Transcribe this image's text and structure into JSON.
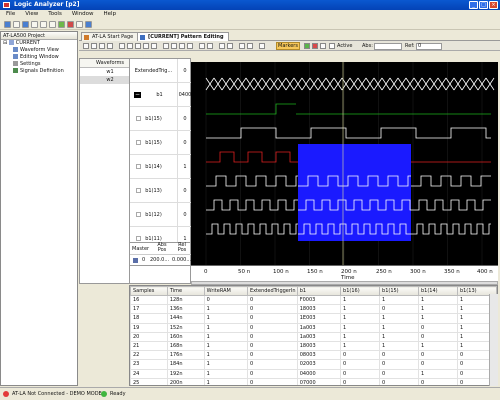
{
  "window": {
    "title": "Logic Analyzer [p2]"
  },
  "menu": [
    "File",
    "View",
    "Tools",
    "Window",
    "Help"
  ],
  "project": {
    "header": "AT-LA500 Project",
    "root": "CURRENT",
    "items": [
      "Waveform View",
      "Editing Window",
      "Settings",
      "Signals Definition"
    ]
  },
  "tabs": [
    {
      "label": "AT-LA Start Page",
      "active": false
    },
    {
      "label": "[CURRENT] Pattern Editing",
      "active": true
    }
  ],
  "controls": {
    "markers_label": "Markers",
    "active_label": "Active",
    "abs_label": "Abs:",
    "ref_label": "Ref:",
    "abs_value": "",
    "ref_value": "0"
  },
  "waveforms": {
    "header": "Waveforms",
    "items": [
      "w1",
      "w2"
    ],
    "selected": "w2"
  },
  "signals": [
    {
      "name": "ExtendedTrig...",
      "value": "0",
      "color": "#ffffff"
    },
    {
      "name": "b1",
      "value": "0400",
      "color": "#ffffff",
      "group": true
    },
    {
      "name": "b1(15)",
      "value": "0",
      "color": "#1db11d"
    },
    {
      "name": "b1(15)",
      "value": "0",
      "color": "#ffffff"
    },
    {
      "name": "b1(14)",
      "value": "1",
      "color": "#e02020"
    },
    {
      "name": "b1(13)",
      "value": "0",
      "color": "#ffffff"
    },
    {
      "name": "b1(12)",
      "value": "0",
      "color": "#ffffff"
    },
    {
      "name": "b1(11)",
      "value": "1",
      "color": "#ffffff"
    }
  ],
  "marker_table": {
    "headers": [
      "Master",
      "Abs Pos",
      "Rel Pos"
    ],
    "row": [
      "0",
      "200.0...",
      "0.000..."
    ]
  },
  "axis": {
    "ticks": [
      "0",
      "50 n",
      "100 n",
      "150 n",
      "200 n",
      "250 n",
      "300 n",
      "350 n",
      "400 n"
    ],
    "label": "Time"
  },
  "grid": {
    "headers": [
      "Samples",
      "Time",
      "WriteRAM",
      "ExtendedTriggerIn",
      "b1",
      "b1(16)",
      "b1(15)",
      "b1(14)",
      "b1(13)"
    ],
    "rows": [
      [
        "16",
        "128n",
        "0",
        "0",
        "F0003",
        "1",
        "1",
        "1",
        "1"
      ],
      [
        "17",
        "136n",
        "1",
        "0",
        "18003",
        "1",
        "0",
        "1",
        "1"
      ],
      [
        "18",
        "144n",
        "1",
        "0",
        "1E003",
        "1",
        "1",
        "1",
        "1"
      ],
      [
        "19",
        "152n",
        "1",
        "0",
        "1a003",
        "1",
        "1",
        "0",
        "1"
      ],
      [
        "20",
        "160n",
        "1",
        "0",
        "1a003",
        "1",
        "1",
        "0",
        "1"
      ],
      [
        "21",
        "168n",
        "1",
        "0",
        "18003",
        "1",
        "1",
        "1",
        "1"
      ],
      [
        "22",
        "176n",
        "1",
        "0",
        "08003",
        "0",
        "0",
        "0",
        "0"
      ],
      [
        "23",
        "184n",
        "1",
        "0",
        "02003",
        "0",
        "0",
        "0",
        "0"
      ],
      [
        "24",
        "192n",
        "1",
        "0",
        "04000",
        "0",
        "0",
        "1",
        "0"
      ],
      [
        "25",
        "200n",
        "1",
        "0",
        "07000",
        "0",
        "0",
        "0",
        "0"
      ]
    ]
  },
  "status": {
    "left": "AT-LA Not Connected - DEMO MODE",
    "right": "Ready"
  }
}
